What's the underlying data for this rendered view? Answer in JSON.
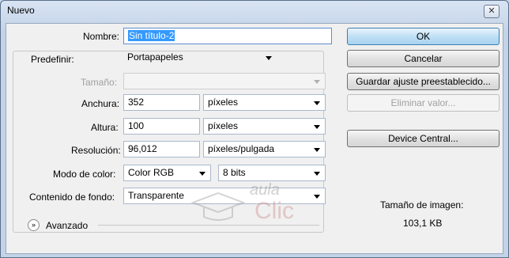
{
  "window": {
    "title": "Nuevo",
    "close_glyph": "✕"
  },
  "form": {
    "nombre": {
      "label": "Nombre:",
      "value": "Sin título-2"
    },
    "predefinir": {
      "label": "Predefinir:",
      "value": "Portapapeles"
    },
    "tamano": {
      "label": "Tamaño:",
      "value": ""
    },
    "anchura": {
      "label": "Anchura:",
      "value": "352",
      "unit": "píxeles"
    },
    "altura": {
      "label": "Altura:",
      "value": "100",
      "unit": "píxeles"
    },
    "resolucion": {
      "label": "Resolución:",
      "value": "96,012",
      "unit": "píxeles/pulgada"
    },
    "modo_color": {
      "label": "Modo de color:",
      "value": "Color RGB",
      "bits": "8 bits"
    },
    "contenido_fondo": {
      "label": "Contenido de fondo:",
      "value": "Transparente"
    },
    "avanzado": {
      "label": "Avanzado",
      "icon": "expand-chevron-icon"
    }
  },
  "buttons": {
    "ok": "OK",
    "cancelar": "Cancelar",
    "guardar": "Guardar ajuste preestablecido...",
    "eliminar": "Eliminar valor...",
    "device_central": "Device Central..."
  },
  "image_size": {
    "label": "Tamaño de imagen:",
    "value": "103,1 KB"
  },
  "watermark": {
    "line1": "aula",
    "line2": "Clic"
  }
}
